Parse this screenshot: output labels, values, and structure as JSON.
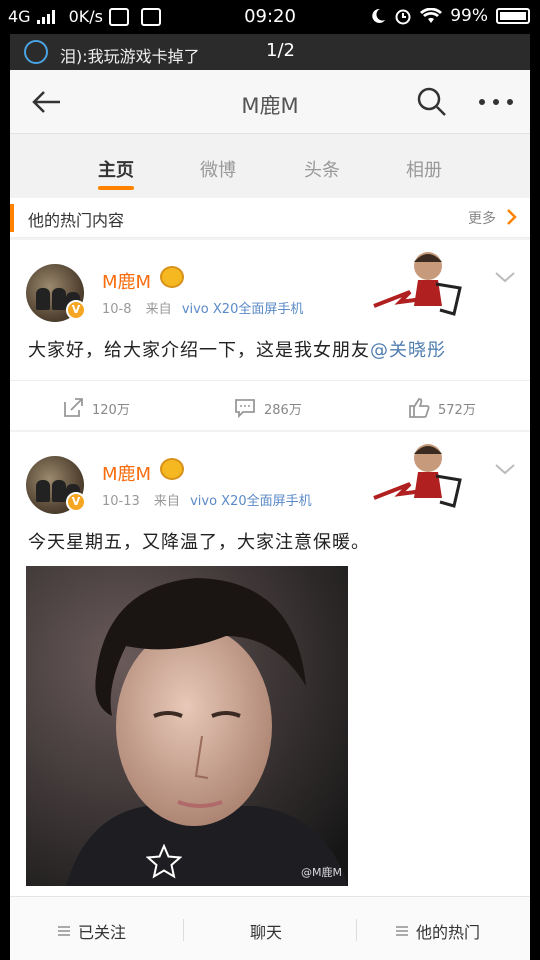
{
  "status_bar": {
    "network": "4G",
    "speed": "0K/s",
    "time": "09:20",
    "battery": "99%"
  },
  "notification": {
    "text": "泪):我玩游戏卡掉了",
    "page": "1/2"
  },
  "nav": {
    "title": "M鹿M"
  },
  "tabs": [
    "主页",
    "微博",
    "头条",
    "相册"
  ],
  "hot_section": {
    "label": "他的热门内容",
    "more": "更多"
  },
  "posts": [
    {
      "author": "M鹿M",
      "date": "10-8",
      "source_prefix": "来自",
      "source": "vivo X20全面屏手机",
      "text": "大家好，给大家介绍一下，这是我女朋友",
      "mention": "@关晓彤",
      "reposts": "120万",
      "comments": "286万",
      "likes": "572万"
    },
    {
      "author": "M鹿M",
      "date": "10-13",
      "source_prefix": "来自",
      "source": "vivo X20全面屏手机",
      "text": "今天星期五，又降温了，大家注意保暖。",
      "watermark": "@M鹿M"
    }
  ],
  "bottom_bar": {
    "followed": "已关注",
    "chat": "聊天",
    "his_hot": "他的热门"
  },
  "colors": {
    "accent": "#ff8200",
    "name": "#f86e0f",
    "link": "#507daf"
  }
}
